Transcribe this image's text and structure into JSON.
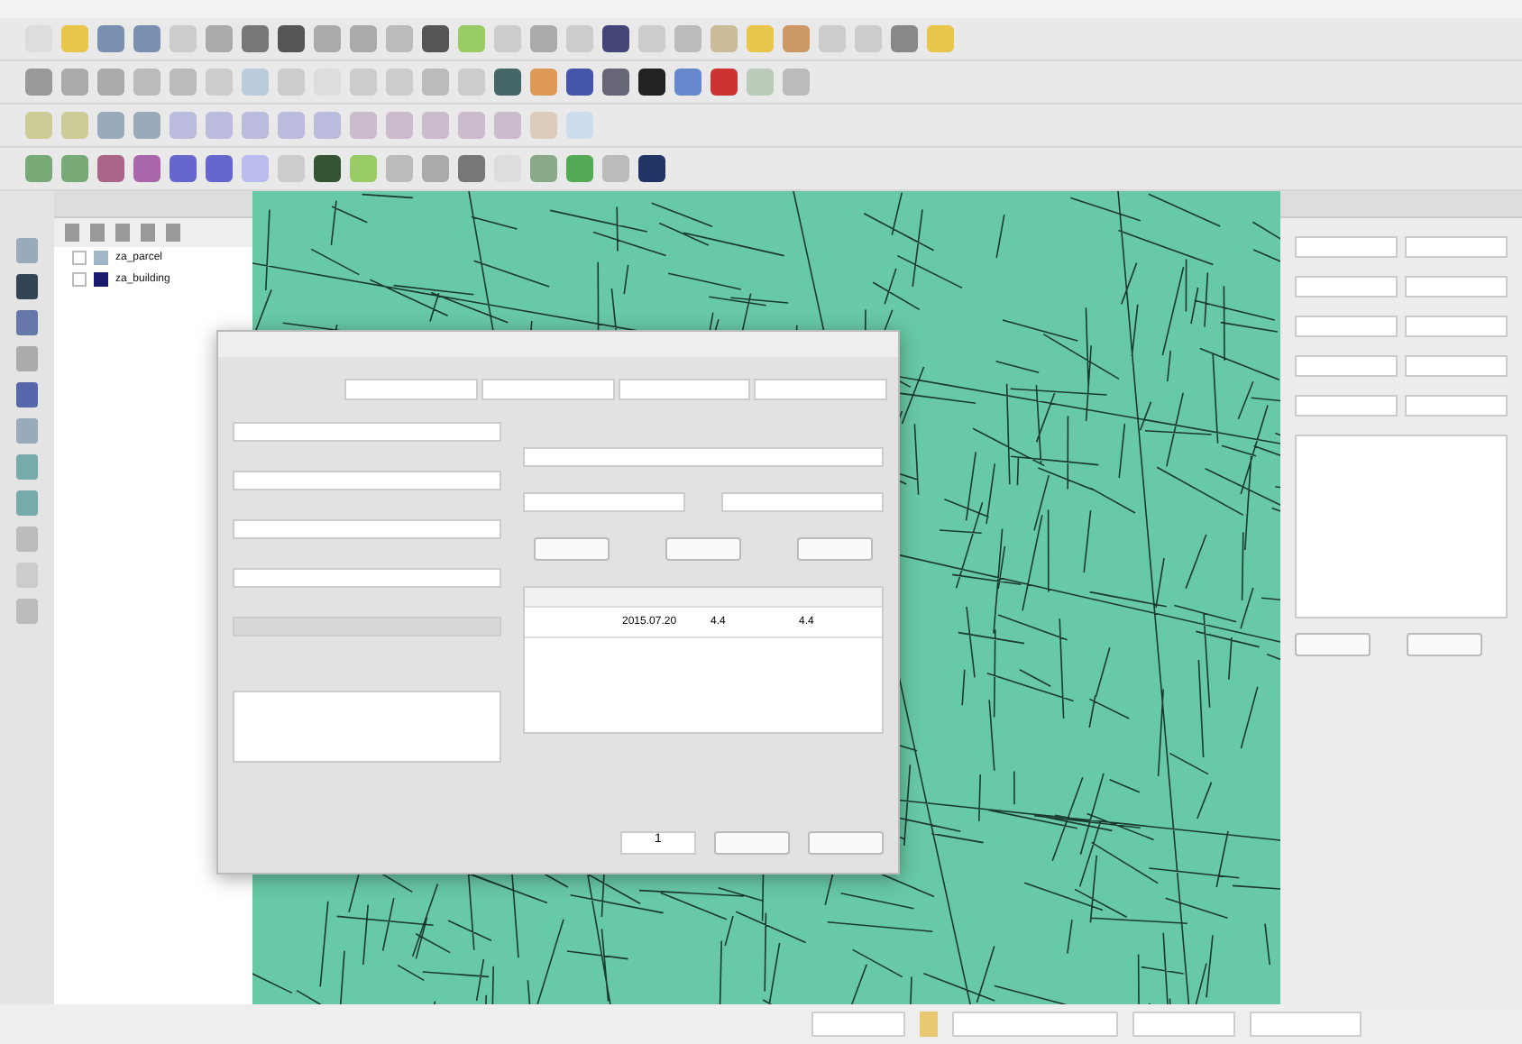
{
  "layers_panel": {
    "layers": [
      {
        "name": "za_parcel",
        "color": "#9fb7c9",
        "checked": false
      },
      {
        "name": "za_building",
        "color": "#1a1a6e",
        "checked": false
      }
    ]
  },
  "dialog": {
    "table": {
      "rows": [
        {
          "cells": [
            "2015.07.20",
            "4.4",
            "4.4"
          ]
        }
      ]
    },
    "page_field": {
      "value": "1"
    }
  }
}
